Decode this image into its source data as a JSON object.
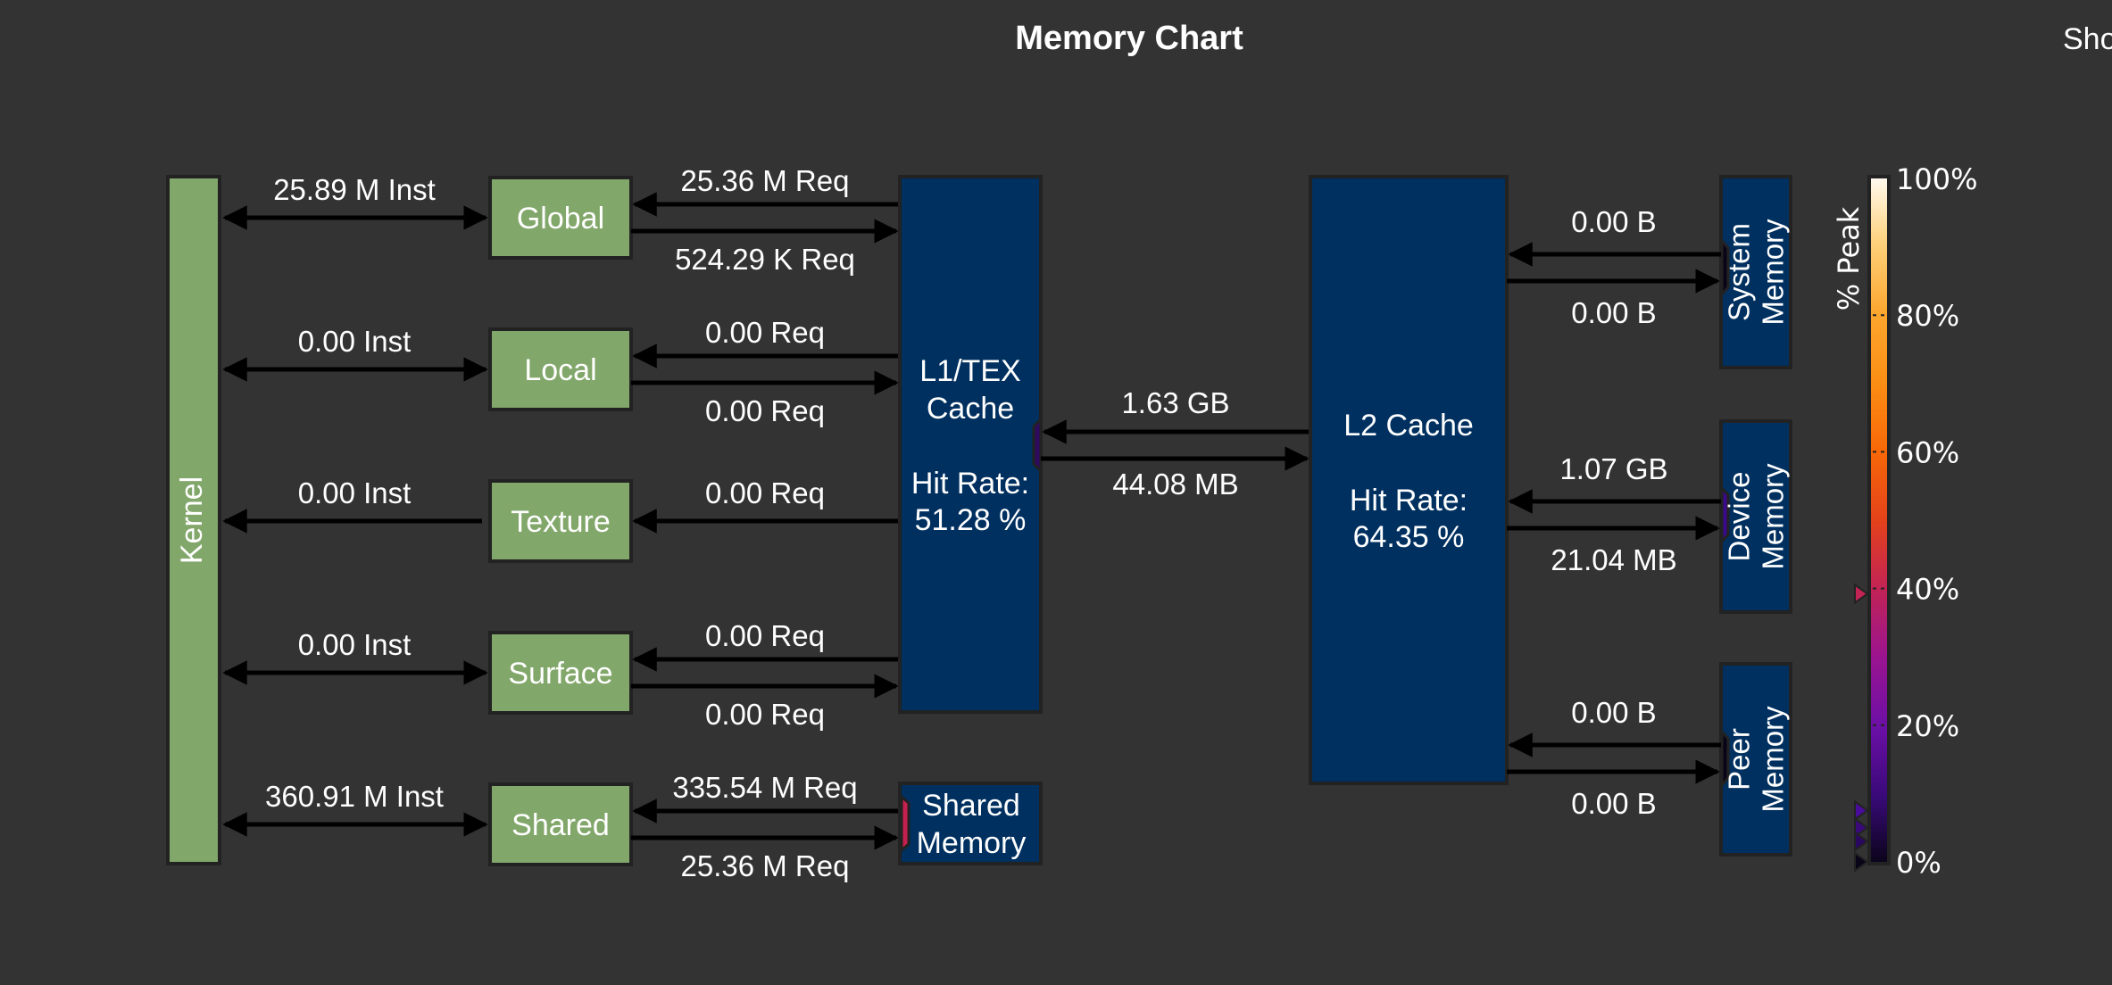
{
  "title": "Memory Chart",
  "show_label": "Sho",
  "colors": {
    "background": "#333333",
    "unit_fill": "#82a76a",
    "cache_fill": "#003060",
    "border": "#222222",
    "arrow": "#000000",
    "text": "#ffffff"
  },
  "kernel": {
    "label": "Kernel"
  },
  "units": [
    {
      "id": "global",
      "label": "Global",
      "kernel_traffic": "25.89 M Inst",
      "kernel_arrow": "both",
      "to_unit": "25.36 M Req",
      "from_unit": "524.29 K Req",
      "l1_arrows": "both"
    },
    {
      "id": "local",
      "label": "Local",
      "kernel_traffic": "0.00 Inst",
      "kernel_arrow": "both",
      "to_unit": "0.00 Req",
      "from_unit": "0.00 Req",
      "l1_arrows": "both"
    },
    {
      "id": "texture",
      "label": "Texture",
      "kernel_traffic": "0.00 Inst",
      "kernel_arrow": "left",
      "to_unit": "0.00 Req",
      "from_unit": "",
      "l1_arrows": "left"
    },
    {
      "id": "surface",
      "label": "Surface",
      "kernel_traffic": "0.00 Inst",
      "kernel_arrow": "both",
      "to_unit": "0.00 Req",
      "from_unit": "0.00 Req",
      "l1_arrows": "both"
    },
    {
      "id": "shared",
      "label": "Shared",
      "kernel_traffic": "360.91 M Inst",
      "kernel_arrow": "both",
      "to_unit": "335.54 M Req",
      "from_unit": "25.36 M Req",
      "l1_arrows": "both"
    }
  ],
  "l1_cache": {
    "label_line1": "L1/TEX",
    "label_line2": "Cache",
    "hit_label": "Hit Rate:",
    "hit_rate": "51.28 %"
  },
  "shared_memory": {
    "label_line1": "Shared",
    "label_line2": "Memory",
    "port_peak_pct": 40
  },
  "l1_l2_link": {
    "to_l1": "1.63 GB",
    "to_l2": "44.08 MB",
    "port_peak_pct": 5
  },
  "l2_cache": {
    "label": "L2 Cache",
    "hit_label": "Hit Rate:",
    "hit_rate": "64.35 %"
  },
  "memories": [
    {
      "id": "system",
      "label_line1": "System",
      "label_line2": "Memory",
      "to_l2": "0.00 B",
      "from_l2": "0.00 B",
      "port_peak_pct": 0
    },
    {
      "id": "device",
      "label_line1": "Device",
      "label_line2": "Memory",
      "to_l2": "1.07 GB",
      "from_l2": "21.04 MB",
      "port_peak_pct": 7
    },
    {
      "id": "peer",
      "label_line1": "Peer",
      "label_line2": "Memory",
      "to_l2": "0.00 B",
      "from_l2": "0.00 B",
      "port_peak_pct": 0
    }
  ],
  "legend": {
    "title": "% Peak",
    "ticks": [
      "0%",
      "20%",
      "40%",
      "60%",
      "80%",
      "100%"
    ],
    "markers_pct": [
      40,
      7,
      5,
      3,
      0
    ]
  }
}
